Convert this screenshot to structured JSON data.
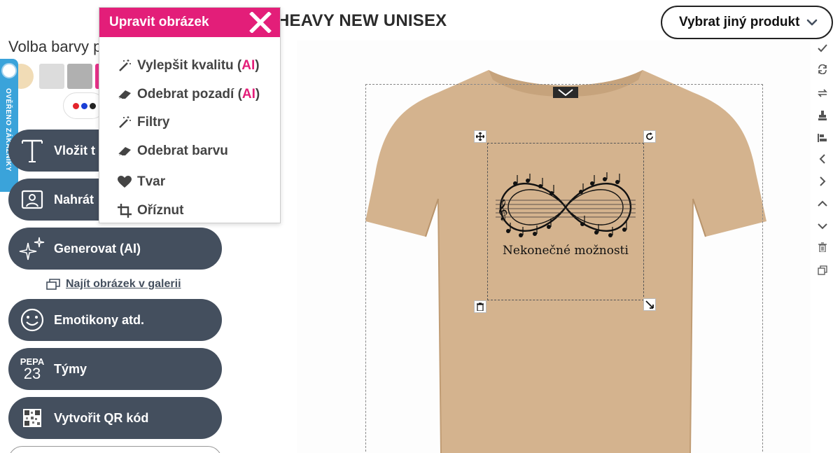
{
  "header": {
    "product_title": "HEAVY NEW UNISEX",
    "choose_product_label": "Vybrat jiný produkt"
  },
  "colors": {
    "label": "Volba barvy p",
    "swatches": [
      "#f1dcb6",
      "#dcdcdc",
      "#b0b0b0",
      "#e8318a"
    ],
    "accent": "#e31e79",
    "button_bg": "#444f5e",
    "verified_bg": "#3aa3da"
  },
  "verified_badge": {
    "text": "OVĚŘENO ZÁKAZNÍKY"
  },
  "tools": {
    "text": "Vložit t",
    "upload": "Nahrát",
    "generate": "Generovat (AI)",
    "gallery_link": "Najít obrázek v galerii",
    "emoji": "Emotikony atd.",
    "teams": "Týmy",
    "teams_icon_top": "PEPA",
    "teams_icon_num": "23",
    "qr": "Vytvořit QR kód"
  },
  "popup": {
    "title": "Upravit obrázek",
    "items": [
      {
        "label": "Vylepšit kvalitu (",
        "ai": "AI",
        "end": ")",
        "icon": "magic-wand-icon"
      },
      {
        "label": "Odebrat pozadí (",
        "ai": "AI",
        "end": ")",
        "icon": "eraser-icon"
      },
      {
        "label": "Filtry",
        "icon": "magic-wand-icon"
      },
      {
        "label": "Odebrat barvu",
        "icon": "eraser-icon"
      },
      {
        "label": "Tvar",
        "icon": "heart-icon"
      },
      {
        "label": "Oříznut",
        "icon": "crop-icon"
      }
    ]
  },
  "design": {
    "caption": "Nekonečné možnosti",
    "art": "infinity-music-notes"
  },
  "shirt_color": "#d4b38e",
  "right_toolbar": [
    "check-icon",
    "refresh-icon",
    "swap-icon",
    "stamp-icon",
    "align-icon",
    "chevron-left-icon",
    "chevron-right-icon",
    "chevron-up-icon",
    "chevron-down-icon",
    "trash-icon",
    "duplicate-icon"
  ]
}
